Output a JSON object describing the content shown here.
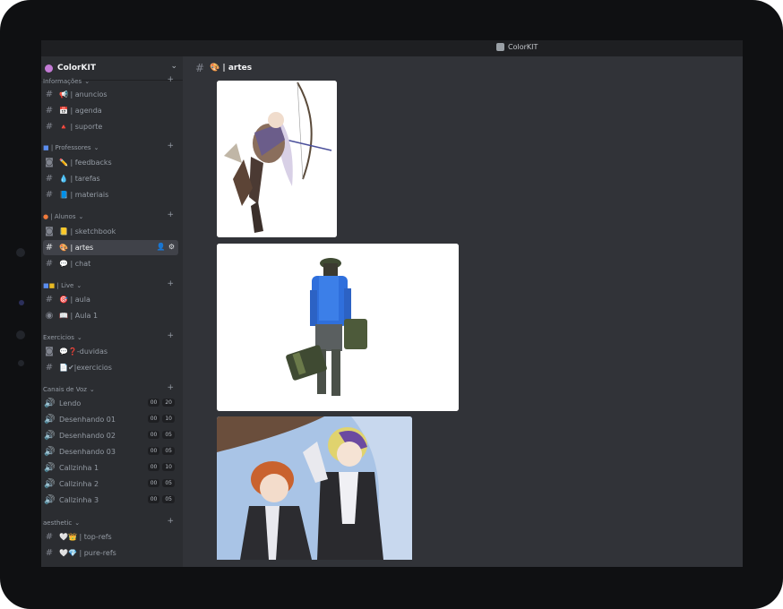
{
  "window": {
    "title": "ColorKIT"
  },
  "server": {
    "name": "ColorKIT"
  },
  "categories": {
    "informacoes": "Informações",
    "professores": "| Professores",
    "alunos": "| Alunos",
    "live": "| Live",
    "exercicios": "Exercicios",
    "canais_de_voz": "Canais de Voz",
    "aesthetic": "aesthetic"
  },
  "channels": {
    "anuncios": "| anuncios",
    "agenda": "| agenda",
    "suporte": "| suporte",
    "feedbacks": "| feedbacks",
    "tarefas": "| tarefas",
    "materiais": "| materiais",
    "sketchbook": "| sketchbook",
    "artes": "| artes",
    "chat": "| chat",
    "aula": "| aula",
    "aula1": "| Aula 1",
    "duvidas": "-duvidas",
    "exercicios": "|exercicios",
    "toprefs": "| top-refs",
    "purerefs": "| pure-refs"
  },
  "voice": [
    {
      "name": "Lendo",
      "a": "00",
      "b": "20"
    },
    {
      "name": "Desenhando 01",
      "a": "00",
      "b": "10"
    },
    {
      "name": "Desenhando 02",
      "a": "00",
      "b": "05"
    },
    {
      "name": "Desenhando 03",
      "a": "00",
      "b": "05"
    },
    {
      "name": "Callzinha 1",
      "a": "00",
      "b": "10"
    },
    {
      "name": "Callzinha 2",
      "a": "00",
      "b": "05"
    },
    {
      "name": "Callzinha 3",
      "a": "00",
      "b": "05"
    }
  ],
  "main": {
    "channel_title": "| artes"
  },
  "icons": [
    "hash-icon",
    "forum-icon",
    "speaker-icon",
    "stage-icon",
    "plus-icon",
    "chevron-down-icon",
    "add-member-icon",
    "gear-icon"
  ],
  "colors": {
    "sidebar": "#2b2d31",
    "main": "#313338",
    "active": "#404249",
    "titlebar": "#1e1f22"
  }
}
